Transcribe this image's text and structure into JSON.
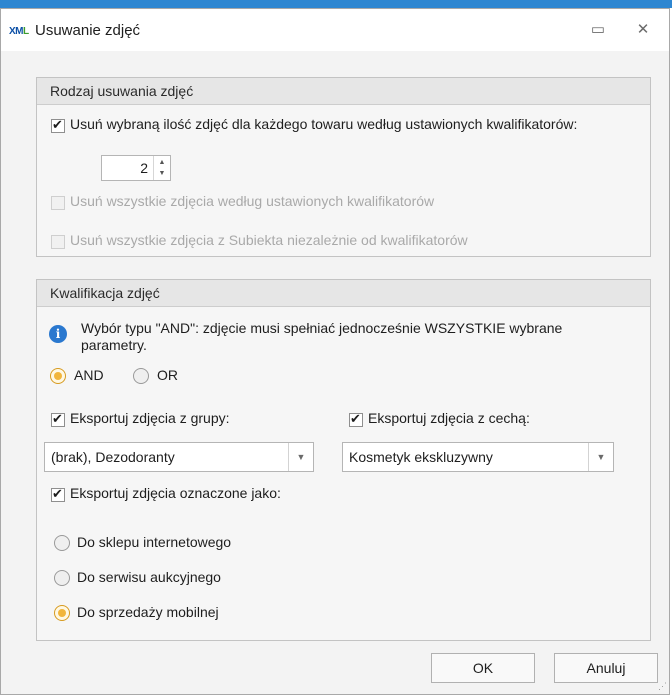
{
  "window": {
    "logo_main": "XML",
    "title": "Usuwanie zdjęć",
    "minimize_glyph": "▭",
    "close_glyph": "✕"
  },
  "group_removal": {
    "header": "Rodzaj usuwania zdjęć",
    "opt_selected": {
      "label": "Usuń wybraną ilość zdjęć dla każdego towaru według ustawionych kwalifikatorów:",
      "checked": true
    },
    "spinner": {
      "value": "2",
      "up": "▲",
      "down": "▼"
    },
    "opt_all_qualifiers": {
      "label": "Usuń wszystkie zdjęcia według ustawionych kwalifikatorów",
      "checked": false,
      "disabled": true
    },
    "opt_all_subiekt": {
      "label": "Usuń wszystkie zdjęcia z Subiekta niezależnie od kwalifikatorów",
      "checked": false,
      "disabled": true
    }
  },
  "group_qualification": {
    "header": "Kwalifikacja zdjęć",
    "info_icon": "i",
    "info_text": "Wybór typu \"AND\": zdjęcie musi spełniać jednocześnie WSZYSTKIE wybrane parametry.",
    "mode": {
      "and_label": "AND",
      "or_label": "OR",
      "selected": "AND"
    },
    "export_group": {
      "label": "Eksportuj zdjęcia z grupy:",
      "checked": true,
      "value": "(brak), Dezodoranty"
    },
    "export_feature": {
      "label": "Eksportuj zdjęcia z cechą:",
      "checked": true,
      "value": "Kosmetyk ekskluzywny"
    },
    "export_marked": {
      "label": "Eksportuj zdjęcia oznaczone jako:",
      "checked": true
    },
    "marked_options": [
      {
        "label": "Do sklepu internetowego",
        "selected": false
      },
      {
        "label": "Do serwisu aukcyjnego",
        "selected": false
      },
      {
        "label": "Do sprzedaży mobilnej",
        "selected": true
      }
    ],
    "dropdown_arrow": "▼"
  },
  "buttons": {
    "ok": "OK",
    "cancel": "Anuluj"
  },
  "colors": {
    "accent_strip": "#2f87d1",
    "radio_selected": "#f1b53c",
    "info_icon": "#2a78cf"
  }
}
